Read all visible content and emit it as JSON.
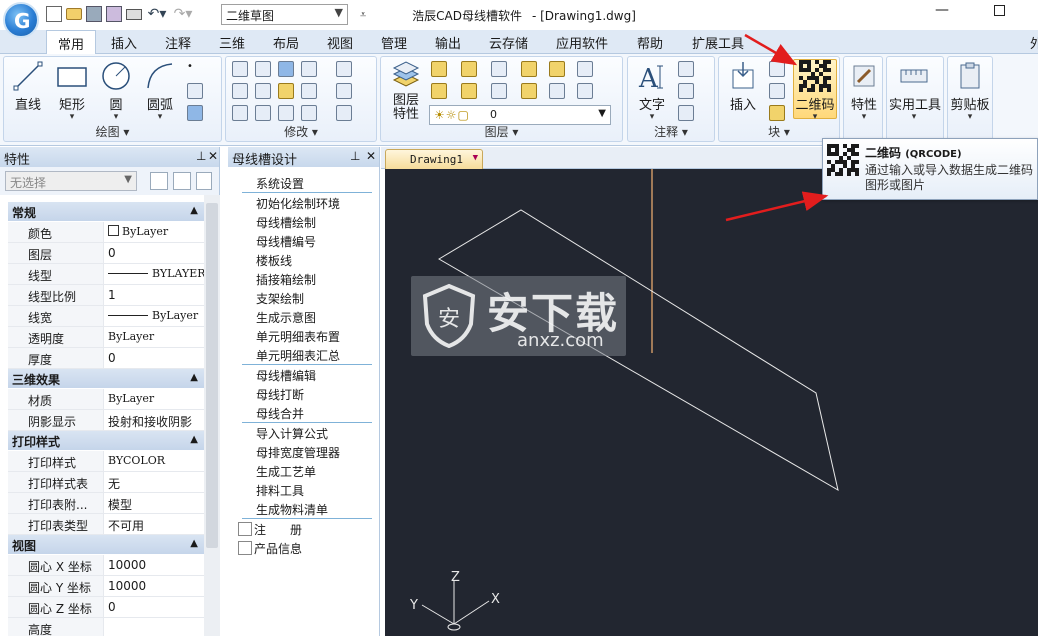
{
  "titlebar": {
    "logo_letter": "G",
    "workspace": "二维草图",
    "app_title": "浩辰CAD母线槽软件",
    "doc_title": "- [Drawing1.dwg]"
  },
  "tabs": [
    "常用",
    "插入",
    "注释",
    "三维",
    "布局",
    "视图",
    "管理",
    "输出",
    "云存储",
    "应用软件",
    "帮助",
    "扩展工具",
    "外"
  ],
  "ribbon": {
    "draw": {
      "label": "绘图",
      "line": "直线",
      "rect": "矩形",
      "circle": "圆",
      "arc": "圆弧"
    },
    "modify": {
      "label": "修改"
    },
    "layer": {
      "label": "图层",
      "props": "图层\n特性",
      "props_l1": "图层",
      "props_l2": "特性",
      "current": "0"
    },
    "annot": {
      "label": "注释",
      "text": "文字"
    },
    "block": {
      "label": "块",
      "insert": "插入",
      "qrcode": "二维码"
    },
    "props": "特性",
    "utils": "实用工具",
    "clip": "剪贴板"
  },
  "tooltip": {
    "title": "二维码",
    "title_en": "(QRCODE)",
    "desc": "通过输入或导入数据生成二维码图形或图片"
  },
  "prop_panel": {
    "title": "特性",
    "selection": "无选择",
    "categories": [
      {
        "name": "常规",
        "rows": [
          {
            "k": "颜色",
            "v": "ByLayer"
          },
          {
            "k": "图层",
            "v": "0"
          },
          {
            "k": "线型",
            "v": "BYLAYER"
          },
          {
            "k": "线型比例",
            "v": "1"
          },
          {
            "k": "线宽",
            "v": "ByLayer"
          },
          {
            "k": "透明度",
            "v": "ByLayer"
          },
          {
            "k": "厚度",
            "v": "0"
          }
        ]
      },
      {
        "name": "三维效果",
        "rows": [
          {
            "k": "材质",
            "v": "ByLayer"
          },
          {
            "k": "阴影显示",
            "v": "投射和接收阴影"
          }
        ]
      },
      {
        "name": "打印样式",
        "rows": [
          {
            "k": "打印样式",
            "v": "BYCOLOR"
          },
          {
            "k": "打印样式表",
            "v": "无"
          },
          {
            "k": "打印表附...",
            "v": "模型"
          },
          {
            "k": "打印表类型",
            "v": "不可用"
          }
        ]
      },
      {
        "name": "视图",
        "rows": [
          {
            "k": "圆心 X 坐标",
            "v": "10000"
          },
          {
            "k": "圆心 Y 坐标",
            "v": "10000"
          },
          {
            "k": "圆心 Z 坐标",
            "v": "0"
          },
          {
            "k": "高度",
            "v": ""
          }
        ]
      }
    ]
  },
  "design_panel": {
    "title": "母线槽设计",
    "groups": [
      [
        "系统设置"
      ],
      [
        "初始化绘制环境",
        "母线槽绘制",
        "母线槽编号",
        "楼板线",
        "插接箱绘制",
        "支架绘制",
        "生成示意图",
        "单元明细表布置",
        "单元明细表汇总"
      ],
      [
        "母线槽编辑",
        "母线打断",
        "母线合并"
      ],
      [
        "导入计算公式",
        "母排宽度管理器",
        "生成工艺单",
        "排料工具",
        "生成物料清单"
      ]
    ],
    "footer": [
      "注　　册",
      "产品信息"
    ]
  },
  "doc_tab": "Drawing1",
  "ucs": {
    "x": "X",
    "y": "Y",
    "z": "Z"
  },
  "watermark": {
    "cn": "安下载",
    "en": "anxz.com"
  }
}
